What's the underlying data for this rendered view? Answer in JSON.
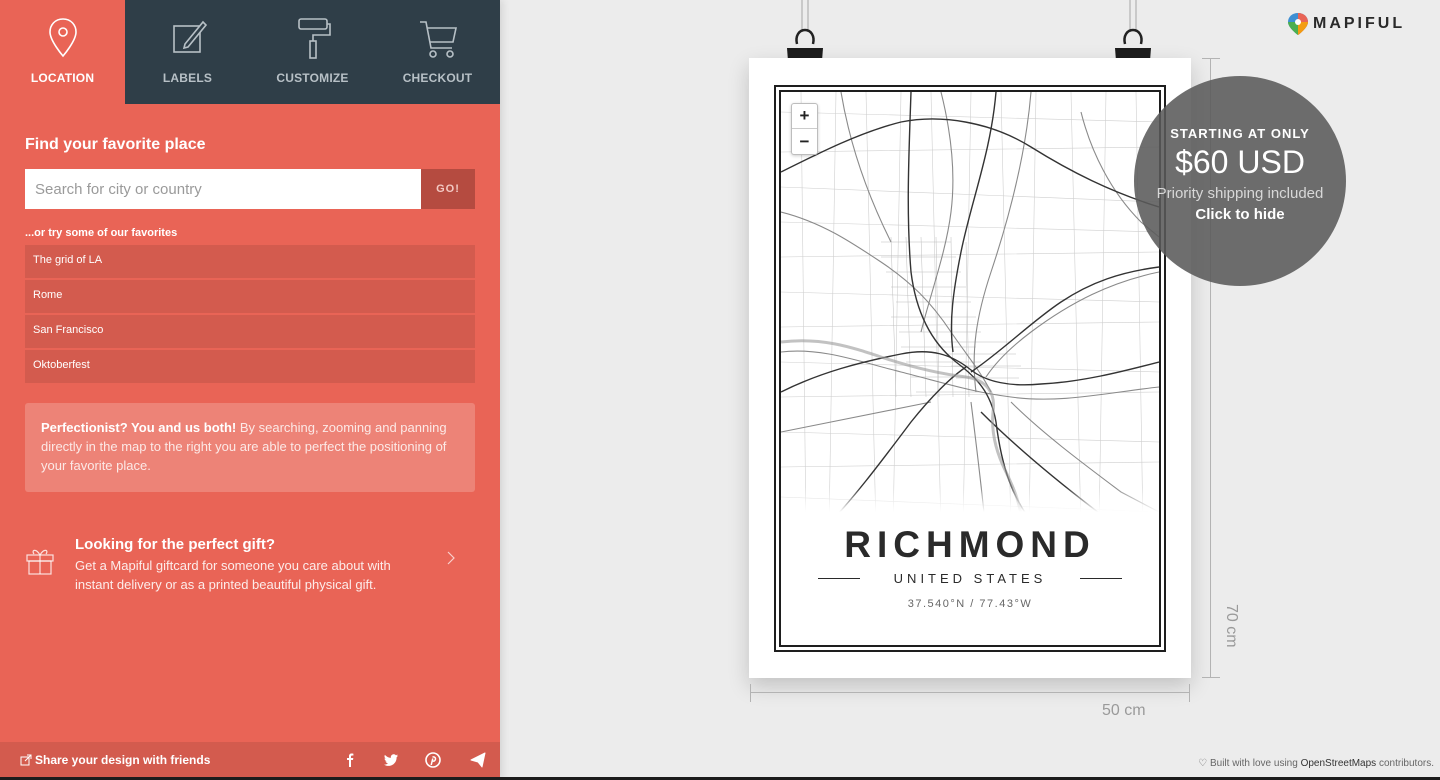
{
  "tabs": [
    {
      "label": "LOCATION",
      "icon": "location-pin-icon",
      "active": true
    },
    {
      "label": "LABELS",
      "icon": "edit-icon",
      "active": false
    },
    {
      "label": "CUSTOMIZE",
      "icon": "paint-roller-icon",
      "active": false
    },
    {
      "label": "CHECKOUT",
      "icon": "cart-icon",
      "active": false
    }
  ],
  "search": {
    "title": "Find your favorite place",
    "placeholder": "Search for city or country",
    "value": "",
    "go_label": "GO!"
  },
  "favorites": {
    "label": "...or try some of our favorites",
    "items": [
      "The grid of LA",
      "Rome",
      "San Francisco",
      "Oktoberfest"
    ]
  },
  "tip": {
    "bold": "Perfectionist? You and us both!",
    "text": " By searching, zooming and panning directly in the map to the right you are able to perfect the positioning of your favorite place."
  },
  "gift": {
    "title": "Looking for the perfect gift?",
    "description": "Get a Mapiful giftcard for someone you care about with instant delivery or as a printed beautiful physical gift."
  },
  "share": {
    "label": "Share your design with friends",
    "networks": [
      "facebook-icon",
      "twitter-icon",
      "pinterest-icon",
      "send-icon"
    ]
  },
  "poster": {
    "city": "RICHMOND",
    "country": "UNITED STATES",
    "coordinates": "37.540°N / 77.43°W",
    "zoom_in": "+",
    "zoom_out": "−"
  },
  "dimensions": {
    "height": "70 cm",
    "width": "50 cm"
  },
  "price": {
    "headline": "STARTING AT ONLY",
    "amount": "$60 USD",
    "shipping": "Priority shipping included",
    "hide": "Click to hide"
  },
  "brand": {
    "name": "MAPIFUL",
    "colors": {
      "coral": "#e96456",
      "dark": "#2f3e48",
      "blue": "#3e8fd3",
      "green": "#4caf50",
      "orange": "#f39c12"
    }
  },
  "credits": {
    "prefix": "Built with love using ",
    "link": "OpenStreetMaps",
    "suffix": " contributors."
  }
}
